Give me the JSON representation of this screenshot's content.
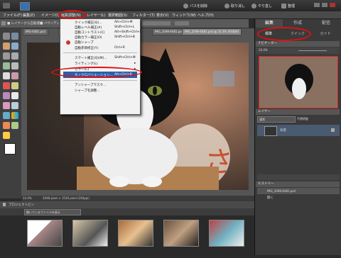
{
  "titlebar": {
    "buttons": [
      {
        "label": "パスを削除",
        "icon": "clear-icon"
      },
      {
        "label": "取り消し",
        "icon": "undo-icon"
      },
      {
        "label": "やり直し",
        "icon": "redo-icon"
      },
      {
        "label": "整理",
        "icon": "organize-icon"
      },
      {
        "label": "作成",
        "icon": "create-icon"
      }
    ]
  },
  "menubar": {
    "items": [
      "ファイル(F)",
      "編集(E)",
      "イメージ(I)",
      "画質調整(N)",
      "レイヤー(L)",
      "選択範囲(S)",
      "フィルター(T)",
      "表示(V)",
      "ウィンドウ(W)",
      "ヘルプ(H)"
    ]
  },
  "optionsbar": {
    "text1": "■ レイヤーから自動選択",
    "text2": "■ バウンディング"
  },
  "doc_tabs": [
    "IMG-6481.psd",
    "IMG-6481.psd",
    "IMG-6483.psd",
    "IMG_2098-6481.psd",
    "IMG_2098-6481.psd @ 33.3% (RGB/8)"
  ],
  "dropdown": {
    "items": [
      {
        "label": "クイック補正(Q)...",
        "shortcut": "Alt+Ctrl+M"
      },
      {
        "label": "自動レベル補正(A)",
        "shortcut": "Shift+Ctrl+L"
      },
      {
        "label": "自動コントラスト(C)",
        "shortcut": "Alt+Shift+Ctrl+L"
      },
      {
        "label": "自動カラー補正(O)",
        "shortcut": "Shift+Ctrl+B"
      },
      {
        "label": "自動シャープ",
        "shortcut": ""
      },
      {
        "label": "自動赤目修正(Y)",
        "shortcut": "Ctrl+R"
      },
      {
        "label": "スマート補正(Q)(M)...",
        "shortcut": "Shift+Ctrl+M"
      },
      {
        "label": "ライティング(L)",
        "shortcut": "▸"
      },
      {
        "label": "カラー(C)",
        "shortcut": "▸"
      },
      {
        "label": "モノクロバリエーション...",
        "shortcut": "Alt+Ctrl+B"
      },
      {
        "label": "アンシャープマスク...",
        "shortcut": ""
      },
      {
        "label": "シャープを調整...",
        "shortcut": ""
      }
    ]
  },
  "statusbar": {
    "zoom": "33.4%",
    "info": "2048 pixel × 1536 pixel (240ppi)"
  },
  "project_bin": {
    "title": "プロジェクトビン",
    "selector": "開いているファイルを表示"
  },
  "right_panel": {
    "tabs": [
      "編集",
      "作成",
      "配信"
    ],
    "subtabs": [
      "標準",
      "クイック",
      "ガイド"
    ],
    "navigator_label": "ナビゲーター",
    "zoom": "33.4%",
    "layers_label": "レイヤー",
    "blend_mode": "通常",
    "opacity_label": "不透明度",
    "layer_name": "背景",
    "history_label": "ヒストリー",
    "history_items": [
      "開く",
      "開く"
    ],
    "history_file": "IMG_2098-6481.psd"
  },
  "colors": {
    "highlight": "#e01010",
    "menu_bg": "#4a4a4a",
    "dropdown_select": "#2d5ea8"
  }
}
